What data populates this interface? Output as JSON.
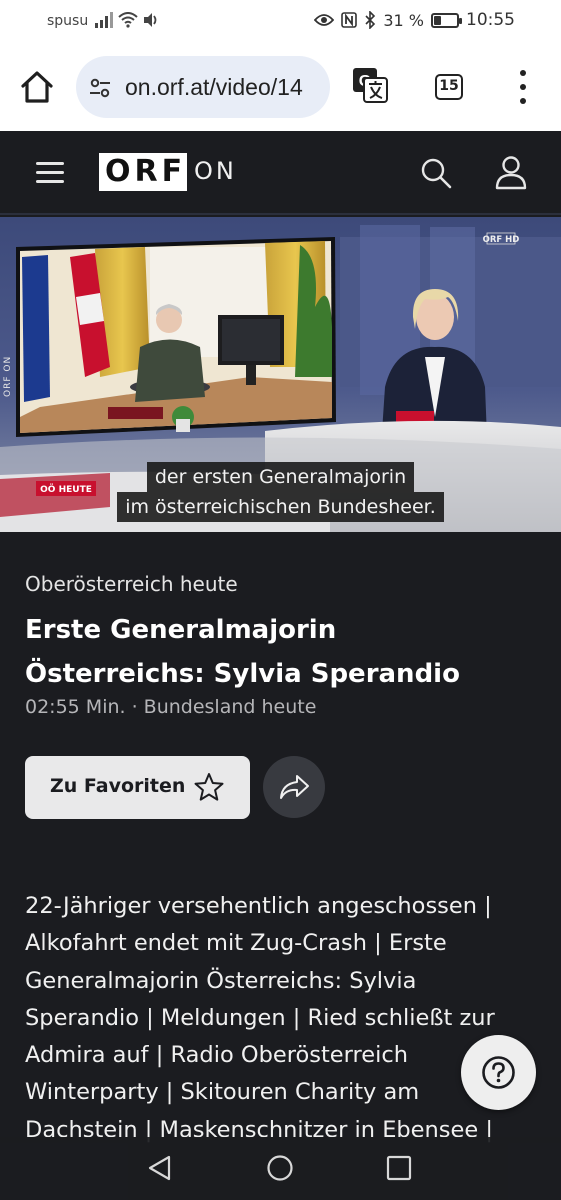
{
  "status_bar": {
    "carrier": "spusu",
    "battery_percent": "31 %",
    "battery_level": 0.31,
    "time": "10:55",
    "icons": [
      "signal-icon",
      "wifi-icon",
      "volume-icon",
      "eye-icon",
      "nfc-icon",
      "bluetooth-icon",
      "battery-icon"
    ]
  },
  "browser": {
    "url": "on.orf.at/video/14",
    "tab_count": "15",
    "icons": [
      "home-icon",
      "site-settings-icon",
      "translate-icon",
      "tabs-icon",
      "more-menu-icon"
    ]
  },
  "orf_header": {
    "logo_text": "ORF",
    "brand_suffix": "ON",
    "icons": [
      "hamburger-menu-icon",
      "search-icon",
      "user-icon"
    ]
  },
  "video": {
    "channel_badge": "ORF HD",
    "side_label": "ORF ON",
    "show_badge": "OÖ HEUTE",
    "subtitles": [
      "der ersten Generalmajorin",
      "im österreichischen Bundesheer."
    ]
  },
  "episode": {
    "show_name": "Oberösterreich heute",
    "title_lines": [
      "Erste Generalmajorin",
      "Österreichs: Sylvia Sperandio"
    ],
    "meta": "02:55 Min. · Bundesland heute",
    "favorite_label": "Zu Favoriten",
    "description_lines": [
      "22-Jähriger versehentlich angeschossen |",
      "Alkofahrt endet mit Zug-Crash | Erste",
      "Generalmajorin Österreichs: Sylvia",
      "Sperandio | Meldungen | Ried schließt zur",
      "Admira auf | Radio Oberösterreich",
      "Winterparty | Skitouren Charity am",
      "Dachstein | Maskenschnitzer in Ebensee |"
    ]
  },
  "colors": {
    "page_bg": "#1b1c20",
    "orf_red": "#c8102e",
    "button_light": "#e9e9ea",
    "url_pill": "#e8edf7"
  }
}
